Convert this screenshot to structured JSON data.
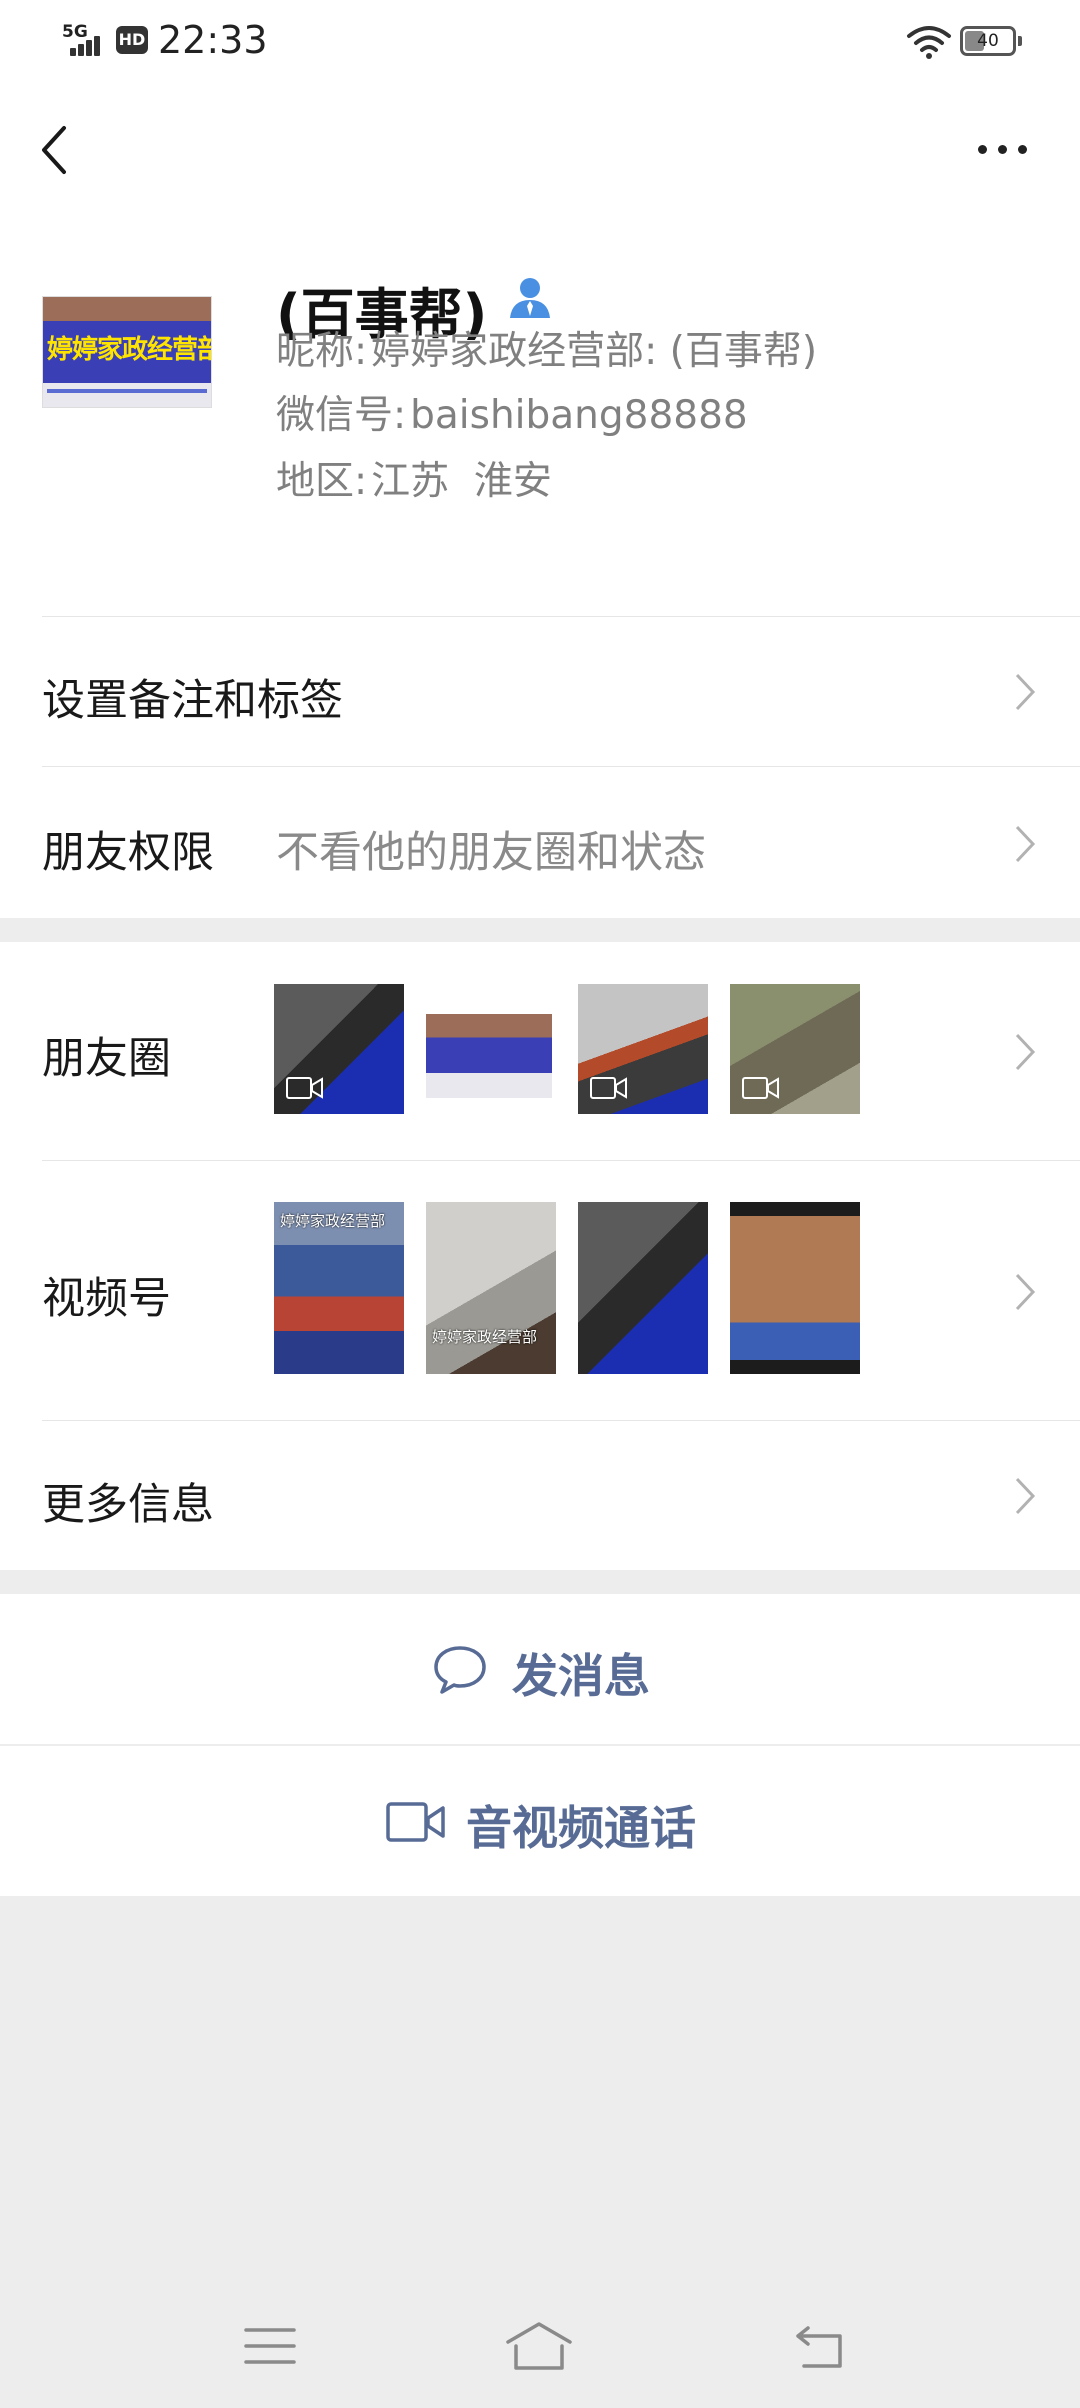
{
  "status_bar": {
    "network": "5G",
    "hd": "HD",
    "time": "22:33",
    "battery": "40"
  },
  "profile": {
    "name": "(百事帮)",
    "avatar_sign": "婷婷家政经营部",
    "nickname_label": "昵称:",
    "nickname_value": "婷婷家政经营部: (百事帮)",
    "wechat_id_label": "微信号:",
    "wechat_id_value": "baishibang88888",
    "region_label": "地区:",
    "region_value": "江苏  淮安"
  },
  "rows": {
    "remark": {
      "label": "设置备注和标签"
    },
    "permission": {
      "label": "朋友权限",
      "value": "不看他的朋友圈和状态"
    },
    "moments": {
      "label": "朋友圈"
    },
    "channels": {
      "label": "视频号",
      "captions": [
        "婷婷家政经营部",
        "婷婷家政经营部"
      ]
    },
    "more": {
      "label": "更多信息"
    }
  },
  "actions": {
    "message": "发消息",
    "call": "音视频通话"
  },
  "icons": {
    "back": "back-arrow-icon",
    "more": "more-dots-icon",
    "person": "person-icon",
    "chevron": "chevron-right-icon",
    "chat": "chat-bubble-icon",
    "video": "video-camera-icon",
    "menu": "menu-icon",
    "home": "home-icon",
    "return": "return-icon"
  },
  "colors": {
    "accent": "#576b95",
    "person_icon": "#4a90e2",
    "background": "#ededed"
  }
}
